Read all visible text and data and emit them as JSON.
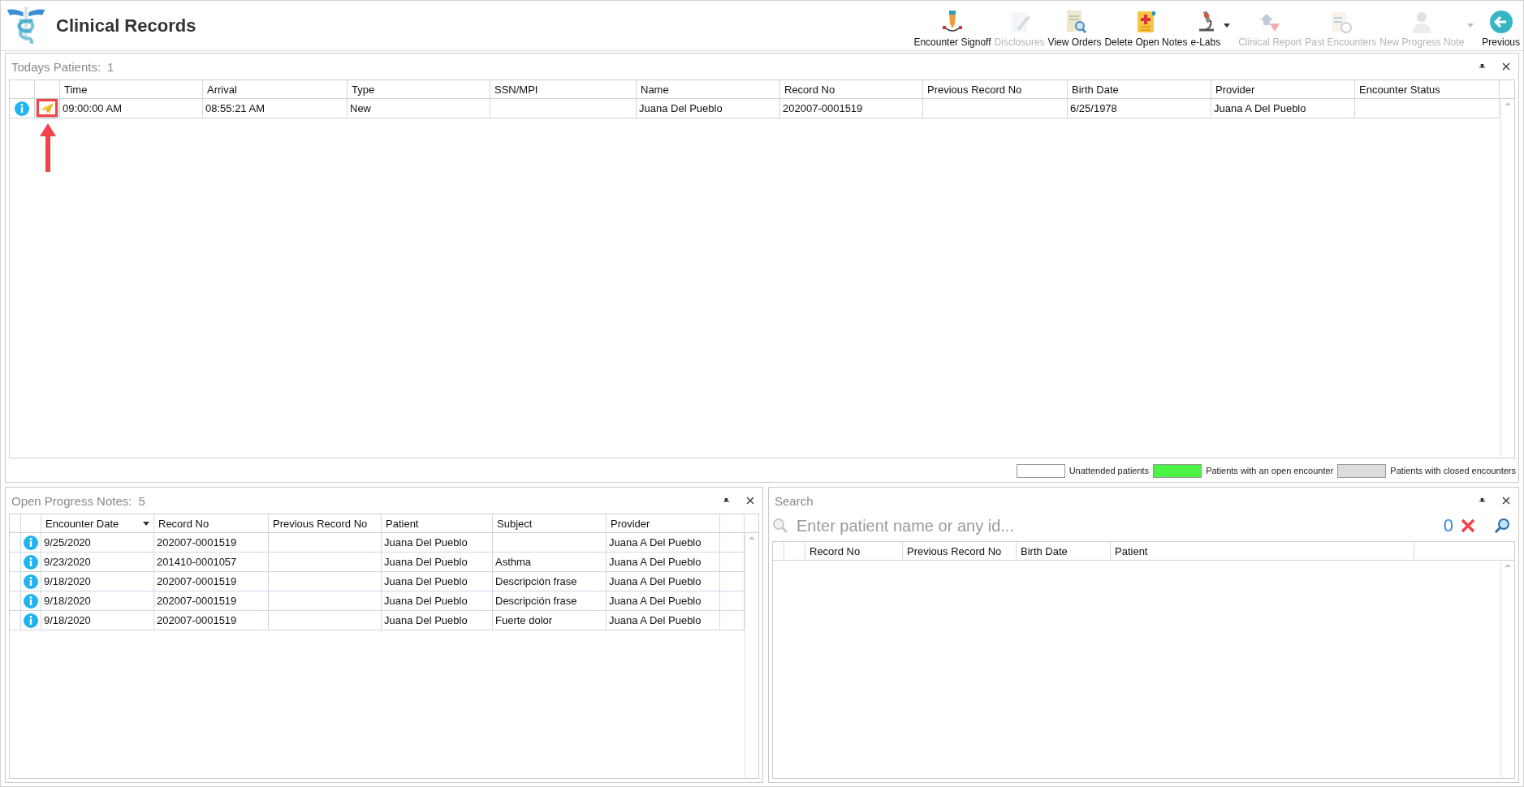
{
  "app": {
    "title": "Clinical Records"
  },
  "toolbar": [
    {
      "label": "Encounter Signoff",
      "disabled": false,
      "has_menu": false
    },
    {
      "label": "Disclosures",
      "disabled": true,
      "has_menu": false
    },
    {
      "label": "View Orders",
      "disabled": false,
      "has_menu": false
    },
    {
      "label": "Delete Open Notes",
      "disabled": false,
      "has_menu": false
    },
    {
      "label": "e-Labs",
      "disabled": false,
      "has_menu": true
    },
    {
      "label": "Clinical Report",
      "disabled": true,
      "has_menu": false
    },
    {
      "label": "Past Encounters",
      "disabled": true,
      "has_menu": false
    },
    {
      "label": "New Progress Note",
      "disabled": true,
      "has_menu": true
    },
    {
      "label": "Previous",
      "disabled": false,
      "has_menu": false
    }
  ],
  "todays_patients": {
    "title": "Todays Patients:",
    "count": "1",
    "columns": [
      "Time",
      "Arrival",
      "Type",
      "SSN/MPI",
      "Name",
      "Record No",
      "Previous Record No",
      "Birth Date",
      "Provider",
      "Encounter Status"
    ],
    "rows": [
      {
        "callout": true,
        "cells": [
          "09:00:00 AM",
          "08:55:21 AM",
          "New",
          "",
          "Juana Del Pueblo",
          "202007-0001519",
          "",
          "6/25/1978",
          "Juana A Del Pueblo",
          ""
        ]
      }
    ],
    "legend": [
      {
        "label": "Unattended patients",
        "color": "#ffffff"
      },
      {
        "label": "Patients with an open encounter",
        "color": "#4cf244"
      },
      {
        "label": "Patients with closed encounters",
        "color": "#dcdcdc"
      }
    ]
  },
  "open_progress_notes": {
    "title": "Open Progress Notes:",
    "count": "5",
    "columns": [
      {
        "label": "Encounter Date",
        "sorted": true
      },
      {
        "label": "Record No",
        "sorted": false
      },
      {
        "label": "Previous Record No",
        "sorted": false
      },
      {
        "label": "Patient",
        "sorted": false
      },
      {
        "label": "Subject",
        "sorted": false
      },
      {
        "label": "Provider",
        "sorted": false
      }
    ],
    "rows": [
      [
        "9/25/2020",
        "202007-0001519",
        "",
        "Juana Del Pueblo",
        "",
        "Juana A Del Pueblo"
      ],
      [
        "9/23/2020",
        "201410-0001057",
        "",
        "Juana Del Pueblo",
        "Asthma",
        "Juana A Del Pueblo"
      ],
      [
        "9/18/2020",
        "202007-0001519",
        "",
        "Juana Del Pueblo",
        "Descripción frase",
        "Juana A Del Pueblo"
      ],
      [
        "9/18/2020",
        "202007-0001519",
        "",
        "Juana Del Pueblo",
        "Descripción frase",
        "Juana A Del Pueblo"
      ],
      [
        "9/18/2020",
        "202007-0001519",
        "",
        "Juana Del Pueblo",
        "Fuerte dolor",
        "Juana A Del Pueblo"
      ]
    ]
  },
  "search": {
    "title": "Search",
    "placeholder": "Enter patient name or any id...",
    "result_count": "0",
    "columns": [
      "Record No",
      "Previous Record No",
      "Birth Date",
      "Patient"
    ]
  }
}
